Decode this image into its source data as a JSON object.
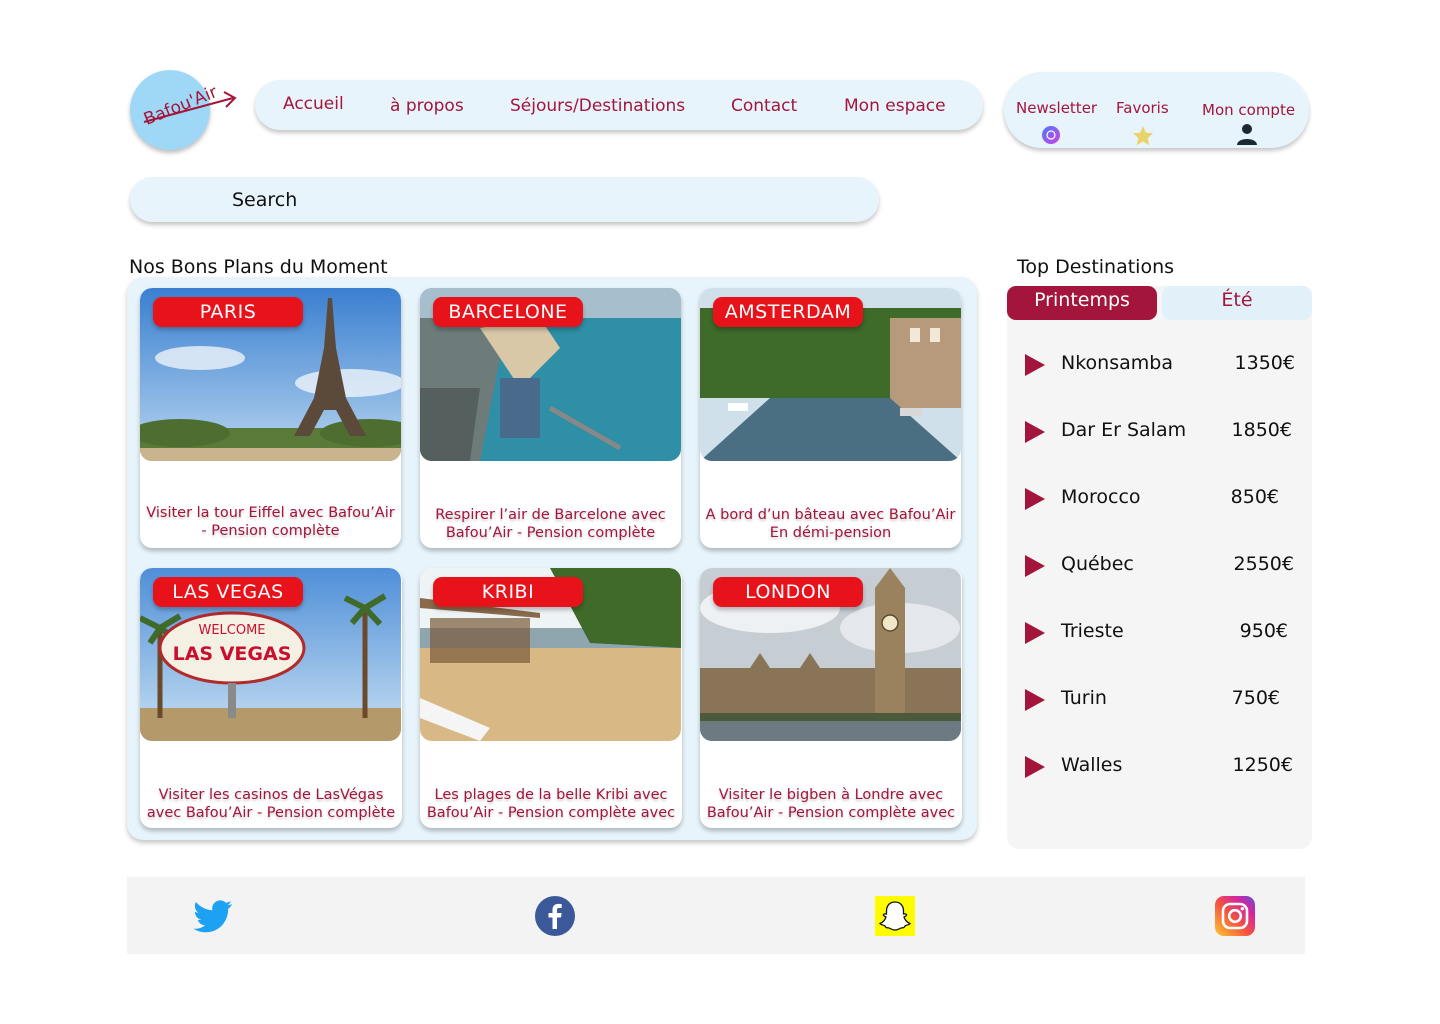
{
  "brand": {
    "logo_text": "Bafou'Air"
  },
  "nav": {
    "items": [
      "Accueil",
      "à propos",
      "Séjours/Destinations",
      "Contact",
      "Mon espace"
    ]
  },
  "account": {
    "items": [
      "Newsletter",
      "Favoris",
      "Mon compte"
    ]
  },
  "search": {
    "placeholder": "Search"
  },
  "deals": {
    "title": "Nos Bons Plans du Moment",
    "cards": [
      {
        "city": "PARIS",
        "desc": "Visiter la tour Eiffel  avec Bafou’Air - Pension complète"
      },
      {
        "city": "BARCELONE",
        "desc": "Respirer l’air de Barcelone  avec Bafou’Air - Pension complète"
      },
      {
        "city": "AMSTERDAM",
        "desc": "A bord d’un bâteau  avec Bafou’Air En démi-pension"
      },
      {
        "city": "LAS VEGAS",
        "desc": "Visiter les casinos de LasVégas avec Bafou’Air - Pension complète"
      },
      {
        "city": "KRIBI",
        "desc": "Les plages de la belle Kribi  avec Bafou’Air - Pension complète avec"
      },
      {
        "city": "LONDON",
        "desc": "Visiter le bigben à Londre  avec Bafou’Air - Pension complète avec"
      }
    ]
  },
  "top_destinations": {
    "title": "Top Destinations",
    "tabs": [
      "Printemps",
      "Été"
    ],
    "items": [
      {
        "name": "Nkonsamba",
        "price": "1350€"
      },
      {
        "name": "Dar Er Salam",
        "price": "1850€"
      },
      {
        "name": "Morocco",
        "price": "850€"
      },
      {
        "name": "Québec",
        "price": "2550€"
      },
      {
        "name": "Trieste",
        "price": "950€"
      },
      {
        "name": "Turin",
        "price": "750€"
      },
      {
        "name": "Walles",
        "price": "1250€"
      }
    ]
  },
  "footer": {
    "social_icons": [
      "twitter-icon",
      "facebook-icon",
      "snapchat-icon",
      "instagram-icon"
    ]
  },
  "colors": {
    "accent": "#a3153a",
    "badge": "#e8121a",
    "panel": "#e7f4fb",
    "logo": "#9fd8f6"
  }
}
